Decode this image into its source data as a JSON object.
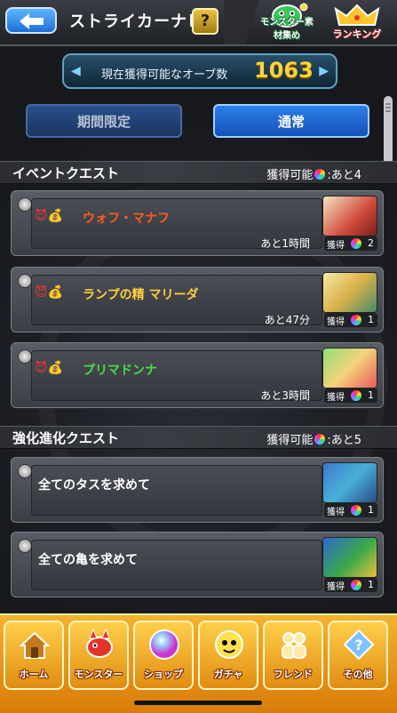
{
  "header": {
    "title": "ストライカーナビ",
    "help": "?",
    "monster_material": "モンスター素材集め",
    "ranking": "ランキング"
  },
  "orb": {
    "label": "現在獲得可能なオーブ数",
    "count": "1063"
  },
  "tabs": {
    "limited": "期間限定",
    "normal": "通常"
  },
  "event_section": {
    "title": "イベントクエスト",
    "remaining": "獲得可能",
    "remaining_count": ":あと4",
    "quests": [
      {
        "name": "ウォフ・マナフ",
        "name_color": "#ff5a1e",
        "time": "あと1時間",
        "get_label": "獲得",
        "get_count": "2"
      },
      {
        "name": "ランプの精 マリーダ",
        "name_color": "#ffd23a",
        "time": "あと47分",
        "get_label": "獲得",
        "get_count": "1"
      },
      {
        "name": "プリマドンナ",
        "name_color": "#46e046",
        "time": "あと3時間",
        "get_label": "獲得",
        "get_count": "1"
      }
    ]
  },
  "evolution_section": {
    "title": "強化進化クエスト",
    "remaining": "獲得可能",
    "remaining_count": ":あと5",
    "quests": [
      {
        "name": "全てのタスを求めて",
        "get_label": "獲得",
        "get_count": "1"
      },
      {
        "name": "全ての亀を求めて",
        "get_label": "獲得",
        "get_count": "1"
      }
    ]
  },
  "bottom_nav": {
    "home": "ホーム",
    "monster": "モンスター",
    "shop": "ショップ",
    "gacha": "ガチャ",
    "friend": "フレンド",
    "other": "その他"
  },
  "colors": {
    "accent": "#1f6fe0",
    "orb_count": "#ffd43a",
    "nav": "#f0a01f"
  }
}
